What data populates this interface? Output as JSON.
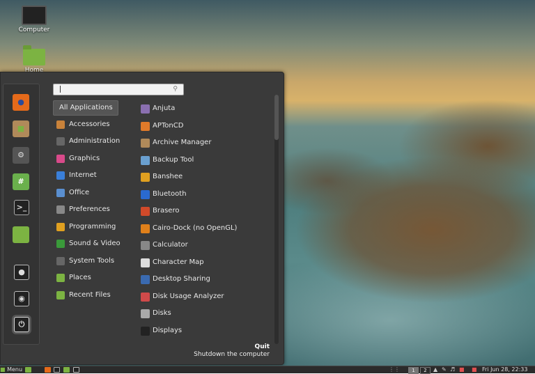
{
  "desktop": {
    "icons": [
      {
        "label": "Computer",
        "icon": "computer-icon"
      },
      {
        "label": "Home",
        "icon": "home-folder-icon"
      }
    ]
  },
  "menu": {
    "search": {
      "value": "",
      "placeholder": ""
    },
    "favorites": [
      {
        "name": "firefox",
        "icon": "firefox-icon",
        "color": "#e56a1a"
      },
      {
        "name": "software-manager",
        "icon": "package-icon",
        "color": "#b08a5a"
      },
      {
        "name": "system-settings",
        "icon": "settings-icon",
        "color": "#555555"
      },
      {
        "name": "terminal-green",
        "icon": "hashtag-terminal-icon",
        "color": "#6ab04c"
      },
      {
        "name": "terminal",
        "icon": "terminal-icon",
        "color": "#222222"
      },
      {
        "name": "files",
        "icon": "folder-icon",
        "color": "#7cb342"
      },
      {
        "name": "lock-screen",
        "icon": "lock-icon",
        "color": "#222222"
      },
      {
        "name": "logout",
        "icon": "logout-icon",
        "color": "#222222"
      },
      {
        "name": "shutdown",
        "icon": "power-icon",
        "color": "#222222"
      }
    ],
    "categories": [
      {
        "label": "All Applications",
        "icon": "",
        "color": "",
        "selected": true
      },
      {
        "label": "Accessories",
        "icon": "accessories-icon",
        "color": "#c9823a"
      },
      {
        "label": "Administration",
        "icon": "administration-icon",
        "color": "#666666"
      },
      {
        "label": "Graphics",
        "icon": "graphics-icon",
        "color": "#d94a8a"
      },
      {
        "label": "Internet",
        "icon": "internet-icon",
        "color": "#3a7fd9"
      },
      {
        "label": "Office",
        "icon": "office-icon",
        "color": "#5a8fd0"
      },
      {
        "label": "Preferences",
        "icon": "preferences-icon",
        "color": "#888888"
      },
      {
        "label": "Programming",
        "icon": "programming-icon",
        "color": "#e0a020"
      },
      {
        "label": "Sound & Video",
        "icon": "sound-video-icon",
        "color": "#3a9a3a"
      },
      {
        "label": "System Tools",
        "icon": "system-tools-icon",
        "color": "#666666"
      },
      {
        "label": "Places",
        "icon": "places-icon",
        "color": "#7cb342"
      },
      {
        "label": "Recent Files",
        "icon": "recent-files-icon",
        "color": "#7cb342"
      }
    ],
    "apps": [
      {
        "label": "Anjuta",
        "icon": "anjuta-icon",
        "color": "#8a6fb0"
      },
      {
        "label": "APTonCD",
        "icon": "aptoncd-icon",
        "color": "#e07a2a"
      },
      {
        "label": "Archive Manager",
        "icon": "archive-manager-icon",
        "color": "#b08a5a"
      },
      {
        "label": "Backup Tool",
        "icon": "backup-tool-icon",
        "color": "#6aa0d0"
      },
      {
        "label": "Banshee",
        "icon": "banshee-icon",
        "color": "#e0a020"
      },
      {
        "label": "Bluetooth",
        "icon": "bluetooth-icon",
        "color": "#2a6ad0"
      },
      {
        "label": "Brasero",
        "icon": "brasero-icon",
        "color": "#d04a2a"
      },
      {
        "label": "Cairo-Dock (no OpenGL)",
        "icon": "cairo-dock-icon",
        "color": "#e0801a"
      },
      {
        "label": "Calculator",
        "icon": "calculator-icon",
        "color": "#888888"
      },
      {
        "label": "Character Map",
        "icon": "character-map-icon",
        "color": "#dddddd"
      },
      {
        "label": "Desktop Sharing",
        "icon": "desktop-sharing-icon",
        "color": "#3a6ab0"
      },
      {
        "label": "Disk Usage Analyzer",
        "icon": "disk-usage-icon",
        "color": "#d04a4a"
      },
      {
        "label": "Disks",
        "icon": "disks-icon",
        "color": "#aaaaaa"
      },
      {
        "label": "Displays",
        "icon": "displays-icon",
        "color": "#222222"
      }
    ],
    "quit": {
      "title": "Quit",
      "description": "Shutdown the computer"
    }
  },
  "panel": {
    "menu_label": "Menu",
    "workspaces": [
      "1",
      "2"
    ],
    "clock": "Fri Jun 28, 22:33"
  }
}
